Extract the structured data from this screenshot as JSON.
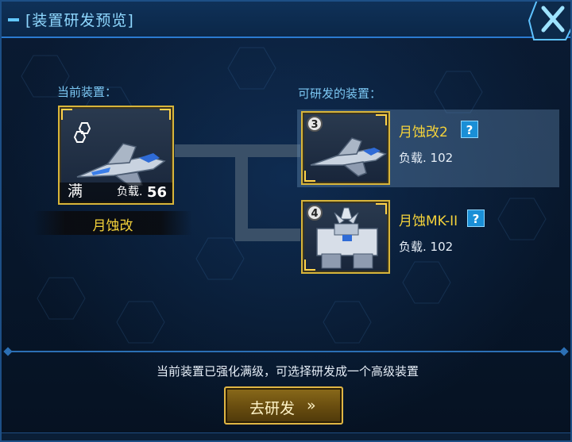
{
  "window": {
    "title": "[装置研发预览]",
    "close_icon": "close-icon"
  },
  "current": {
    "section_label": "当前装置：",
    "level_text": "满",
    "load_label": "负载.",
    "load_value": "56",
    "name": "月蚀改",
    "icon": "jet-fighter-icon"
  },
  "targets": {
    "section_label": "可研发的装置：",
    "options": [
      {
        "rank": "3",
        "name": "月蚀改2",
        "help": "?",
        "load": "负载. 102",
        "icon": "jet-fighter-icon",
        "selected": true
      },
      {
        "rank": "4",
        "name": "月蚀MK-II",
        "help": "?",
        "load": "负载. 102",
        "icon": "mech-robot-icon",
        "selected": false
      }
    ]
  },
  "hint_text": "当前装置已强化满级，可选择研发成一个高级装置",
  "go_button": {
    "label": "去研发",
    "arrow": "»"
  },
  "colors": {
    "accent_gold": "#f4d23a",
    "accent_blue": "#7cc8f4",
    "frame_gold": "#d8b53a",
    "panel_bg": "#0a1b33"
  }
}
